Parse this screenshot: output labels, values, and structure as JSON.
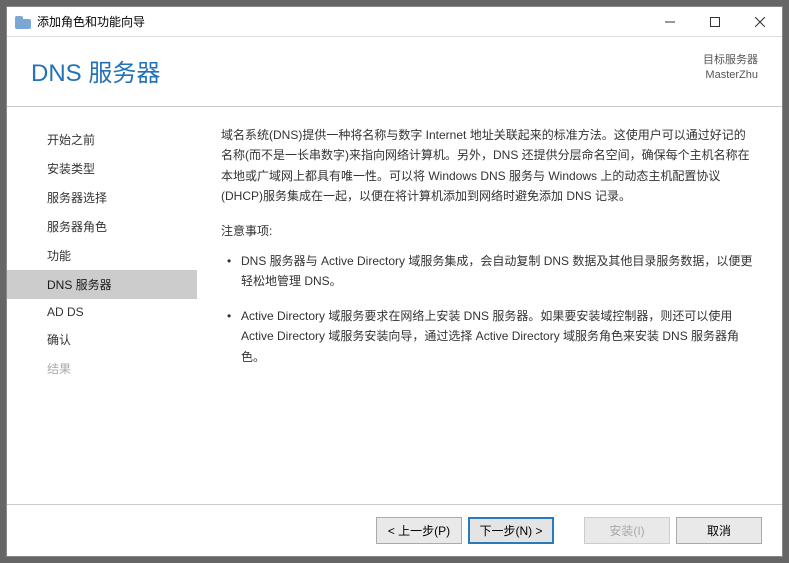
{
  "titlebar": {
    "text": "添加角色和功能向导"
  },
  "header": {
    "title": "DNS 服务器",
    "target_label": "目标服务器",
    "target_name": "MasterZhu"
  },
  "sidebar": {
    "items": [
      {
        "label": "开始之前"
      },
      {
        "label": "安装类型"
      },
      {
        "label": "服务器选择"
      },
      {
        "label": "服务器角色"
      },
      {
        "label": "功能"
      },
      {
        "label": "DNS 服务器"
      },
      {
        "label": "AD DS"
      },
      {
        "label": "确认"
      },
      {
        "label": "结果"
      }
    ]
  },
  "content": {
    "intro": "域名系统(DNS)提供一种将名称与数字 Internet 地址关联起来的标准方法。这使用户可以通过好记的名称(而不是一长串数字)来指向网络计算机。另外，DNS 还提供分层命名空间，确保每个主机名称在本地或广域网上都具有唯一性。可以将 Windows DNS 服务与 Windows 上的动态主机配置协议(DHCP)服务集成在一起，以便在将计算机添加到网络时避免添加 DNS 记录。",
    "notes_label": "注意事项:",
    "notes": [
      "DNS 服务器与 Active Directory 域服务集成，会自动复制 DNS 数据及其他目录服务数据，以便更轻松地管理 DNS。",
      "Active Directory 域服务要求在网络上安装 DNS 服务器。如果要安装域控制器，则还可以使用 Active Directory 域服务安装向导，通过选择 Active Directory 域服务角色来安装 DNS 服务器角色。"
    ]
  },
  "footer": {
    "prev": "< 上一步(P)",
    "next": "下一步(N) >",
    "install": "安装(I)",
    "cancel": "取消"
  }
}
